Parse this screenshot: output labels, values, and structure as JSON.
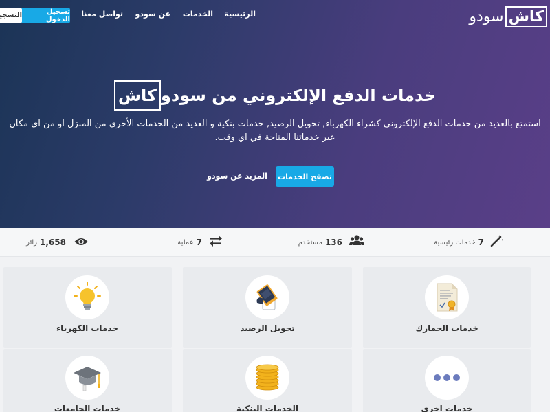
{
  "brand": {
    "boxed": "كاش",
    "plain": "سودو"
  },
  "nav": {
    "items": [
      "الرئيسية",
      "الخدمات",
      "عن سودو",
      "تواصل معنا"
    ],
    "login": "تسجيل الدخول",
    "register": "التسجيل"
  },
  "hero": {
    "title_main": "خدمات الدفع الإلكتروني من سودو",
    "title_boxed": "كاش",
    "description": "استمتع بالعديد من خدمات الدفع الإلكتروني كشراء الكهرباء, تحويل الرصيد, خدمات بنكية و العديد من الخدمات الأخرى من المنزل او من اى مكان عبر خدماتنا المتاحة في اي وقت.",
    "browse_button": "تصفح الخدمات",
    "more_link": "المزيد عن سودو"
  },
  "stats": [
    {
      "value": "7",
      "label": "خدمات رئيسية",
      "icon": "magic-wand-icon"
    },
    {
      "value": "136",
      "label": "مستخدم",
      "icon": "users-icon"
    },
    {
      "value": "7",
      "label": "عملية",
      "icon": "exchange-icon"
    },
    {
      "value": "1,658",
      "label": "زائر",
      "icon": "eye-icon"
    }
  ],
  "cards": [
    {
      "title": "خدمات الجمارك",
      "icon": "customs-document-icon"
    },
    {
      "title": "تحويل الرصيد",
      "icon": "balance-transfer-icon"
    },
    {
      "title": "خدمات الكهرباء",
      "icon": "lightbulb-icon"
    },
    {
      "title": "خدمات اخرى",
      "icon": "more-dots-icon"
    },
    {
      "title": "الخدمات البنكية",
      "icon": "coins-icon"
    },
    {
      "title": "خدمات الجامعات",
      "icon": "graduation-cap-icon"
    }
  ],
  "colors": {
    "accent": "#18a9e6",
    "hero_start": "#1b3456",
    "hero_end": "#5a3f88"
  }
}
